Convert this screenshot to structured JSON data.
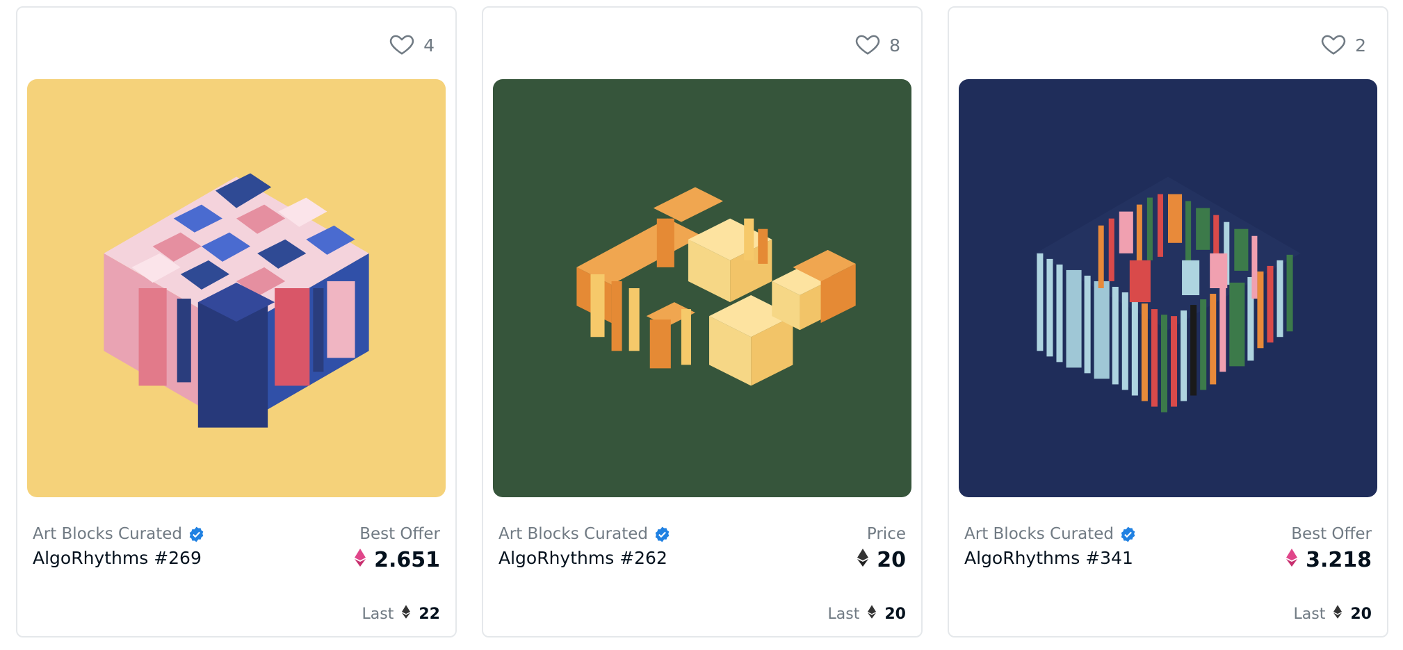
{
  "cards": [
    {
      "favorites": "4",
      "collection": "Art Blocks Curated",
      "title": "AlgoRhythms #269",
      "price_label": "Best Offer",
      "price": "2.651",
      "price_token_color": "#e0468a",
      "last_label": "Last",
      "last_value": "22",
      "art_background": "#f5d27a"
    },
    {
      "favorites": "8",
      "collection": "Art Blocks Curated",
      "title": "AlgoRhythms #262",
      "price_label": "Price",
      "price": "20",
      "price_token_color": "#333333",
      "last_label": "Last",
      "last_value": "20",
      "art_background": "#36553b"
    },
    {
      "favorites": "2",
      "collection": "Art Blocks Curated",
      "title": "AlgoRhythms #341",
      "price_label": "Best Offer",
      "price": "3.218",
      "price_token_color": "#e0468a",
      "last_label": "Last",
      "last_value": "20",
      "art_background": "#1f2d5a"
    }
  ],
  "icons": {
    "favorite": "heart-icon",
    "verified": "verified-badge-icon",
    "currency": "ethereum-icon"
  },
  "colors": {
    "verified": "#2081e2",
    "text_primary": "#04111d",
    "text_secondary": "#707a83",
    "border": "#e5e8eb"
  }
}
